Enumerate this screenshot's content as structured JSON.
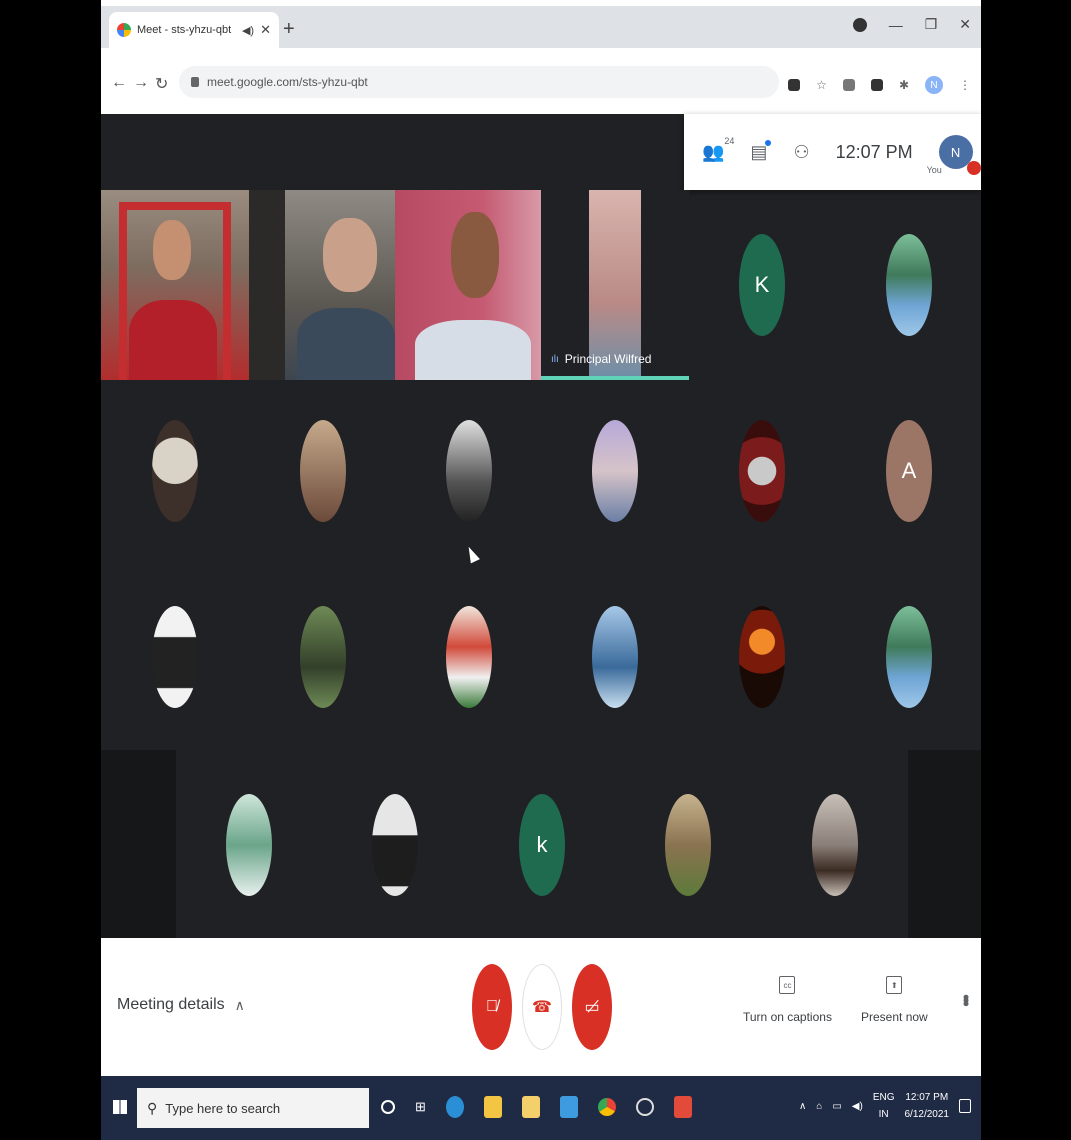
{
  "browser": {
    "tab_title": "Meet - sts-yhzu-qbt",
    "new_tab_glyph": "+",
    "url": "meet.google.com/sts-yhzu-qbt"
  },
  "meet": {
    "participant_count": "24",
    "clock": "12:07 PM",
    "you_label": "You",
    "you_initial": "N",
    "speaker_name": "Principal Wilfred",
    "avatars_row1": [
      "K"
    ],
    "avatars_row2": [
      "A"
    ],
    "avatars_row4": [
      "k"
    ],
    "meeting_details": "Meeting details",
    "captions_label": "Turn on captions",
    "present_label": "Present now",
    "captions_icon_text": "cc"
  },
  "taskbar": {
    "search_placeholder": "Type here to search",
    "language_top": "ENG",
    "language_bottom": "IN",
    "time": "12:07 PM",
    "date": "6/12/2021"
  },
  "colors": {
    "meet_red": "#d93025",
    "meet_bg": "#202124",
    "speaking_highlight": "#5fd3b8"
  }
}
